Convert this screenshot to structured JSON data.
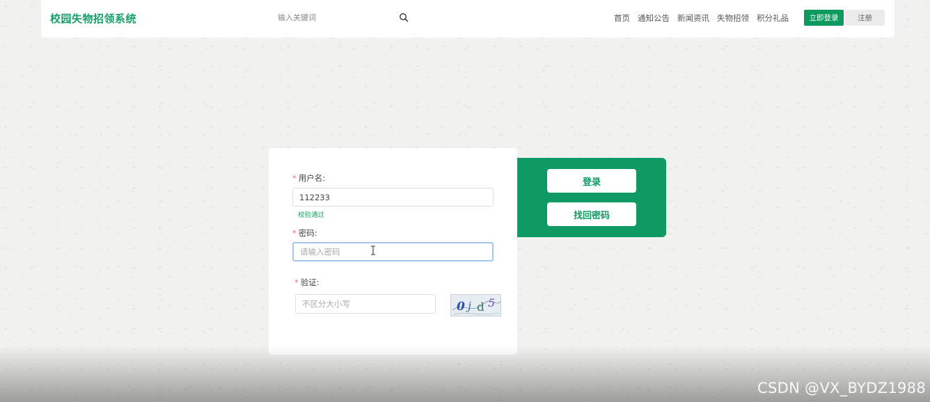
{
  "header": {
    "site_title": "校园失物招领系统",
    "search_placeholder": "输入关键词",
    "nav": [
      "首页",
      "通知公告",
      "新闻资讯",
      "失物招领",
      "积分礼品"
    ],
    "login_button": "立即登录",
    "register_button": "注册"
  },
  "form": {
    "username": {
      "label": "用户名:",
      "value": "112233",
      "hint": "校验通过"
    },
    "password": {
      "label": "密码:",
      "placeholder": "请输入密码"
    },
    "captcha": {
      "label": "验证:",
      "placeholder": "不区分大小写",
      "chars": [
        "0",
        "j",
        "d",
        "5"
      ]
    }
  },
  "actions": {
    "login": "登录",
    "recover": "找回密码"
  },
  "colors": {
    "brand_green": "#0f9a63",
    "required_star": "#f56c6c",
    "focus_border": "#a5c8f0"
  },
  "watermark": "CSDN @VX_BYDZ1988"
}
